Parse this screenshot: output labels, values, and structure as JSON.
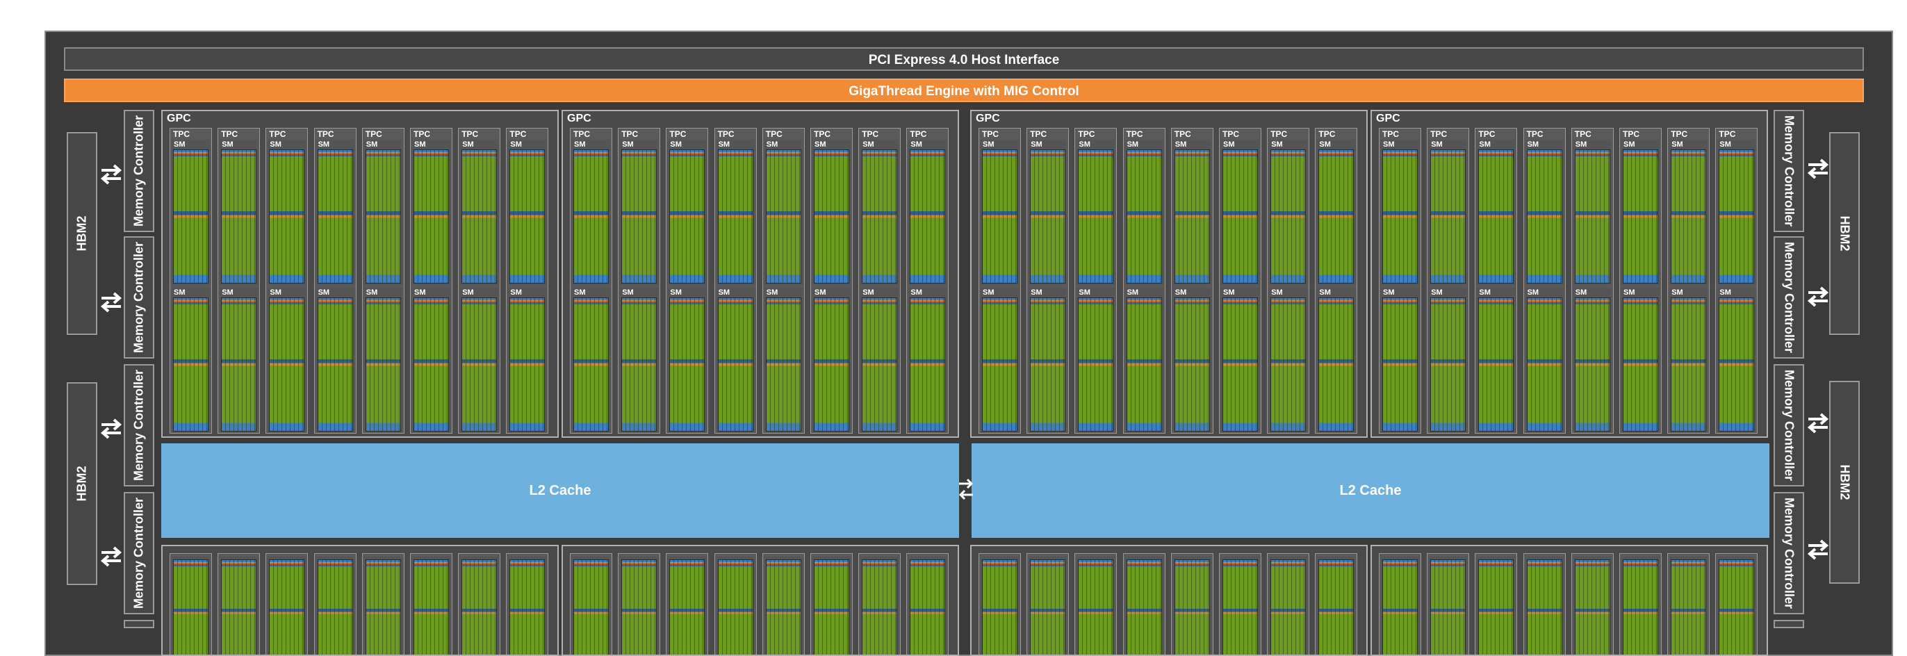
{
  "header": {
    "pcie_label": "PCI Express 4.0 Host Interface",
    "gigathread_label": "GigaThread Engine with MIG Control"
  },
  "memory": {
    "hbm_label": "HBM2",
    "mc_label": "Memory Controller"
  },
  "gpc": {
    "label": "GPC",
    "tpc_label": "TPC",
    "sm_label": "SM"
  },
  "l2": {
    "left_label": "L2 Cache",
    "right_label": "L2 Cache"
  },
  "colors": {
    "chip_bg": "#3a3a3a",
    "gigathread": "#f28b35",
    "l2": "#6eb0de",
    "cuda_core_green": "#6d9b1f"
  },
  "icons": {
    "bidirectional_arrow": "double-arrow-icon"
  }
}
